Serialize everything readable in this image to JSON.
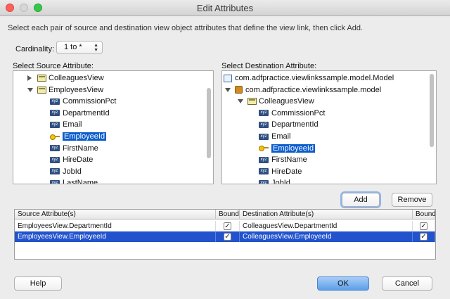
{
  "window": {
    "title": "Edit Attributes"
  },
  "instructions": "Select each pair of source and destination view object attributes that define the view link, then click Add.",
  "cardinality": {
    "label": "Cardinality:",
    "value": "1 to *"
  },
  "source": {
    "label": "Select Source Attribute:",
    "tree": [
      {
        "text": "ColleaguesView",
        "icon": "view-object-icon",
        "expander": "collapsed"
      },
      {
        "text": "EmployeesView",
        "icon": "view-object-icon",
        "expander": "expanded"
      },
      {
        "text": "CommissionPct",
        "icon": "attribute-icon"
      },
      {
        "text": "DepartmentId",
        "icon": "attribute-icon"
      },
      {
        "text": "Email",
        "icon": "attribute-icon"
      },
      {
        "text": "EmployeeId",
        "icon": "key-icon",
        "selected": true
      },
      {
        "text": "FirstName",
        "icon": "attribute-icon"
      },
      {
        "text": "HireDate",
        "icon": "attribute-icon"
      },
      {
        "text": "JobId",
        "icon": "attribute-icon"
      },
      {
        "text": "LastName",
        "icon": "attribute-icon"
      }
    ]
  },
  "destination": {
    "label": "Select Destination Attribute:",
    "tree": [
      {
        "text": "com.adfpractice.viewlinkssample.model.Model",
        "icon": "model-icon"
      },
      {
        "text": "com.adfpractice.viewlinkssample.model",
        "icon": "package-icon",
        "expander": "expanded"
      },
      {
        "text": "ColleaguesView",
        "icon": "view-object-icon",
        "expander": "expanded"
      },
      {
        "text": "CommissionPct",
        "icon": "attribute-icon"
      },
      {
        "text": "DepartmentId",
        "icon": "attribute-icon"
      },
      {
        "text": "Email",
        "icon": "attribute-icon"
      },
      {
        "text": "EmployeeId",
        "icon": "key-icon",
        "selected": true
      },
      {
        "text": "FirstName",
        "icon": "attribute-icon"
      },
      {
        "text": "HireDate",
        "icon": "attribute-icon"
      },
      {
        "text": "JobId",
        "icon": "attribute-icon"
      }
    ]
  },
  "actions": {
    "add": "Add",
    "remove": "Remove"
  },
  "table": {
    "headers": [
      "Source Attribute(s)",
      "Bound",
      "Destination Attribute(s)",
      "Bound"
    ],
    "rows": [
      {
        "source": "EmployeesView.DepartmentId",
        "source_bound": true,
        "dest": "ColleaguesView.DepartmentId",
        "dest_bound": true,
        "selected": false
      },
      {
        "source": "EmployeesView.EmployeeId",
        "source_bound": true,
        "dest": "ColleaguesView.EmployeeId",
        "dest_bound": true,
        "selected": true
      }
    ]
  },
  "footer": {
    "help": "Help",
    "ok": "OK",
    "cancel": "Cancel"
  },
  "colors": {
    "selection": "#0b5ccc",
    "row_selection": "#2253cd",
    "ok_button": "#5d9ee8"
  }
}
